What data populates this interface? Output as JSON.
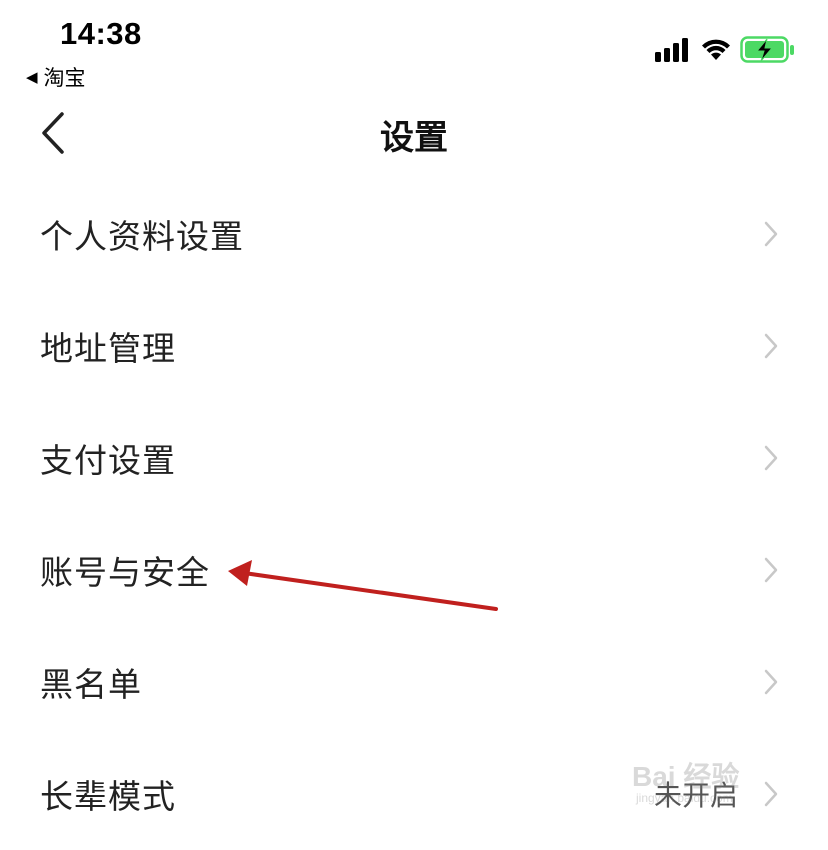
{
  "status_bar": {
    "time": "14:38",
    "back_app_label": "淘宝",
    "icons": [
      "cellular-signal-icon",
      "wifi-icon",
      "battery-charging-icon"
    ],
    "battery_color": "#4cd964"
  },
  "nav": {
    "title": "设置",
    "back_icon": "chevron-left-icon"
  },
  "menu": {
    "items": [
      {
        "label": "个人资料设置",
        "value": ""
      },
      {
        "label": "地址管理",
        "value": ""
      },
      {
        "label": "支付设置",
        "value": ""
      },
      {
        "label": "账号与安全",
        "value": ""
      },
      {
        "label": "黑名单",
        "value": ""
      },
      {
        "label": "长辈模式",
        "value": "未开启"
      }
    ]
  },
  "annotation": {
    "arrow_color": "#c0201e",
    "points_to": "账号与安全"
  },
  "watermark": {
    "text": "Bai 经验",
    "subtext": "jingyan.baidu.com"
  }
}
